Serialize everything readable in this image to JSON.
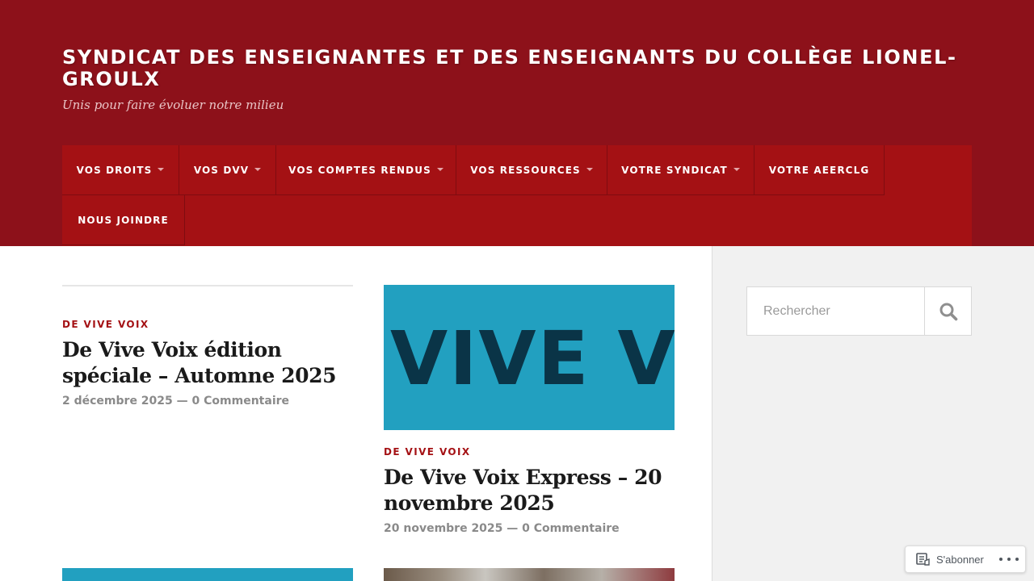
{
  "site": {
    "title": "Syndicat des enseignantes et des enseignants du Collège Lionel-Groulx",
    "tagline": "Unis pour faire évoluer notre milieu"
  },
  "nav": {
    "items": [
      {
        "label": "Vos droits",
        "has_submenu": true
      },
      {
        "label": "Vos DVV",
        "has_submenu": true
      },
      {
        "label": "Vos comptes rendus",
        "has_submenu": true
      },
      {
        "label": "Vos ressources",
        "has_submenu": true
      },
      {
        "label": "Votre syndicat",
        "has_submenu": true
      },
      {
        "label": "Votre AEERCLG",
        "has_submenu": false
      },
      {
        "label": "Nous joindre",
        "has_submenu": false
      }
    ]
  },
  "posts": [
    {
      "category": "De Vive Voix",
      "title": "De Vive Voix édition spéciale – Automne 2025",
      "date": "2 décembre 2025",
      "separator": "—",
      "comments": "0 Commentaire"
    },
    {
      "category": "De Vive Voix",
      "title": "De Vive Voix Express – 20 novembre 2025",
      "date": "20 novembre 2025",
      "separator": "—",
      "comments": "0 Commentaire",
      "thumbnail_text": "VIVE VOIX"
    }
  ],
  "search": {
    "placeholder": "Rechercher",
    "icon": "search-icon"
  },
  "subscribe": {
    "label": "S'abonner",
    "icon": "reader-icon",
    "more_icon": "ellipsis-icon"
  },
  "colors": {
    "header_bg": "#8d111a",
    "nav_bg": "#a41114",
    "accent": "#a41114",
    "thumb_blue": "#22a0c0",
    "thumb_text": "#0a3447",
    "sidebar_bg": "#f1f1f1"
  }
}
